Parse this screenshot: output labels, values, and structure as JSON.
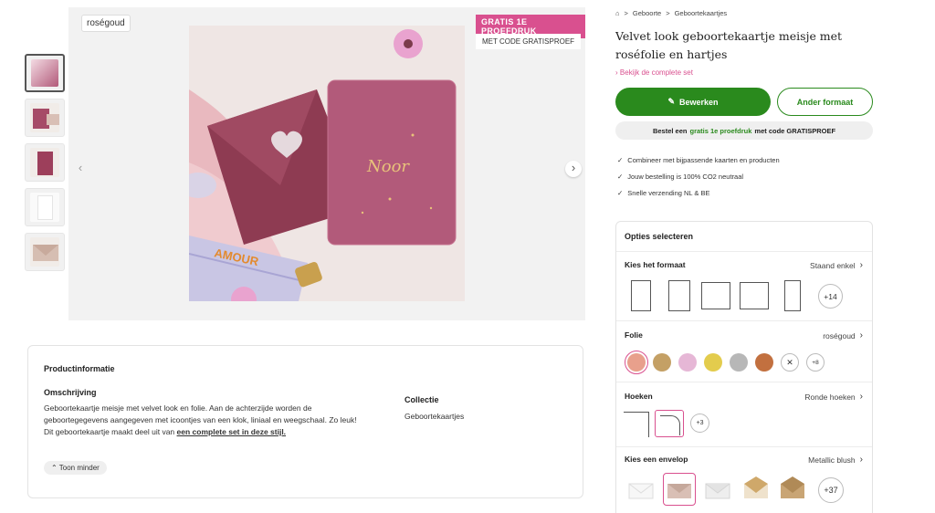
{
  "gallery": {
    "tag": "roségoud",
    "promo_badge": "GRATIS 1E PROEFDRUK",
    "promo_code": "MET CODE GRATISPROEF",
    "photo_text": "AMOUR"
  },
  "info": {
    "title": "Productinformatie",
    "description_title": "Omschrijving",
    "description": "Geboortekaartje meisje met velvet look en folie. Aan de achterzijde worden de geboortegegevens aangegeven met icoontjes van een klok, liniaal en weegschaal. Zo leuk!",
    "set_sentence": "Dit geboortekaartje maakt deel uit van ",
    "set_link": "een complete set in deze stijl.",
    "toggle": "Toon minder",
    "collection_title": "Collectie",
    "collection_value": "Geboortekaartjes"
  },
  "breadcrumb": {
    "items": [
      "Geboorte",
      "Geboortekaartjes"
    ]
  },
  "product": {
    "title": "Velvet look geboortekaartje meisje met roséfolie en hartjes",
    "set_link": "Bekijk de complete set",
    "edit_button": "Bewerken",
    "format_button": "Ander formaat"
  },
  "promo_bar": {
    "pre": "Bestel een",
    "highlight": "gratis 1e proefdruk",
    "post": "met code GRATISPROEF"
  },
  "usps": [
    "Combineer met bijpassende kaarten en producten",
    "Jouw bestelling is 100% CO2 neutraal",
    "Snelle verzending NL & BE"
  ],
  "options": {
    "heading": "Opties selecteren",
    "format": {
      "label": "Kies het formaat",
      "value": "Staand enkel",
      "more": "+14"
    },
    "foil": {
      "label": "Folie",
      "value": "roségoud",
      "more": "+8"
    },
    "corners": {
      "label": "Hoeken",
      "value": "Ronde hoeken",
      "more": "+3"
    },
    "envelope": {
      "label": "Kies een envelop",
      "value": "Metallic blush",
      "more": "+37"
    }
  },
  "colors": {
    "brand_green": "#2a8a1d",
    "accent_pink": "#d9508f",
    "foil_swatches": [
      "#e8a08c",
      "#c4a065",
      "#e6b7d6",
      "#e3cc4d",
      "#b7b7b7",
      "#c2703f"
    ]
  }
}
